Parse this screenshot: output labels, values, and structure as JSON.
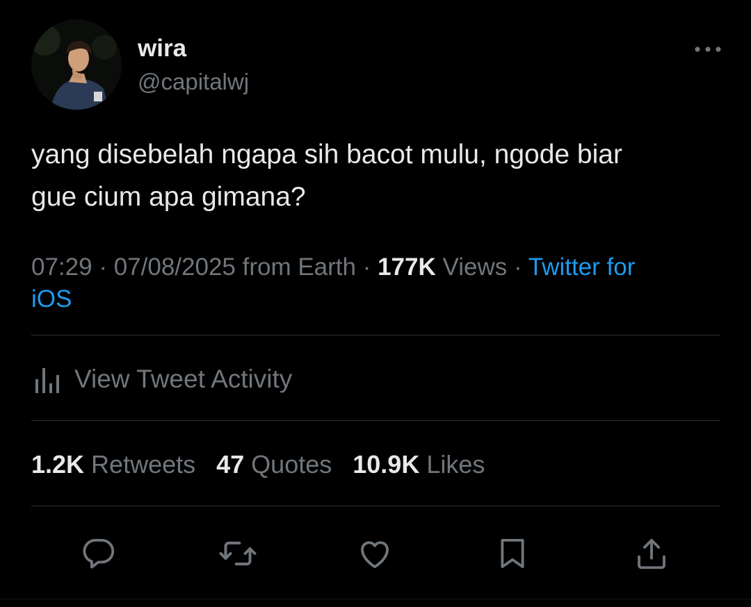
{
  "author": {
    "name": "wira",
    "handle": "@capitalwj"
  },
  "tweet": {
    "line1": "yang disebelah ngapa sih bacot mulu, ngode biar",
    "line2": "gue cium apa gimana?"
  },
  "meta": {
    "time": "07:29",
    "sep1": " · ",
    "date": "07/08/2025",
    "location": " from Earth",
    "sep2": " · ",
    "views_count": "177K",
    "views_label": " Views",
    "sep3": " · ",
    "source_line1": "Twitter for",
    "source_line2": "iOS"
  },
  "activity": {
    "label": "View Tweet Activity"
  },
  "stats": {
    "retweets_count": "1.2K",
    "retweets_label": " Retweets",
    "quotes_count": "47",
    "quotes_label": " Quotes",
    "likes_count": "10.9K",
    "likes_label": " Likes"
  },
  "icons": {
    "more": "more-horizontal-icon",
    "activity": "bar-chart-icon",
    "reply": "reply-icon",
    "retweet": "retweet-icon",
    "like": "heart-icon",
    "bookmark": "bookmark-icon",
    "share": "share-icon"
  },
  "colors": {
    "background": "#000000",
    "text_primary": "#e7e9ea",
    "text_secondary": "#71767b",
    "accent": "#1d9bf0",
    "divider": "#2f3336"
  }
}
